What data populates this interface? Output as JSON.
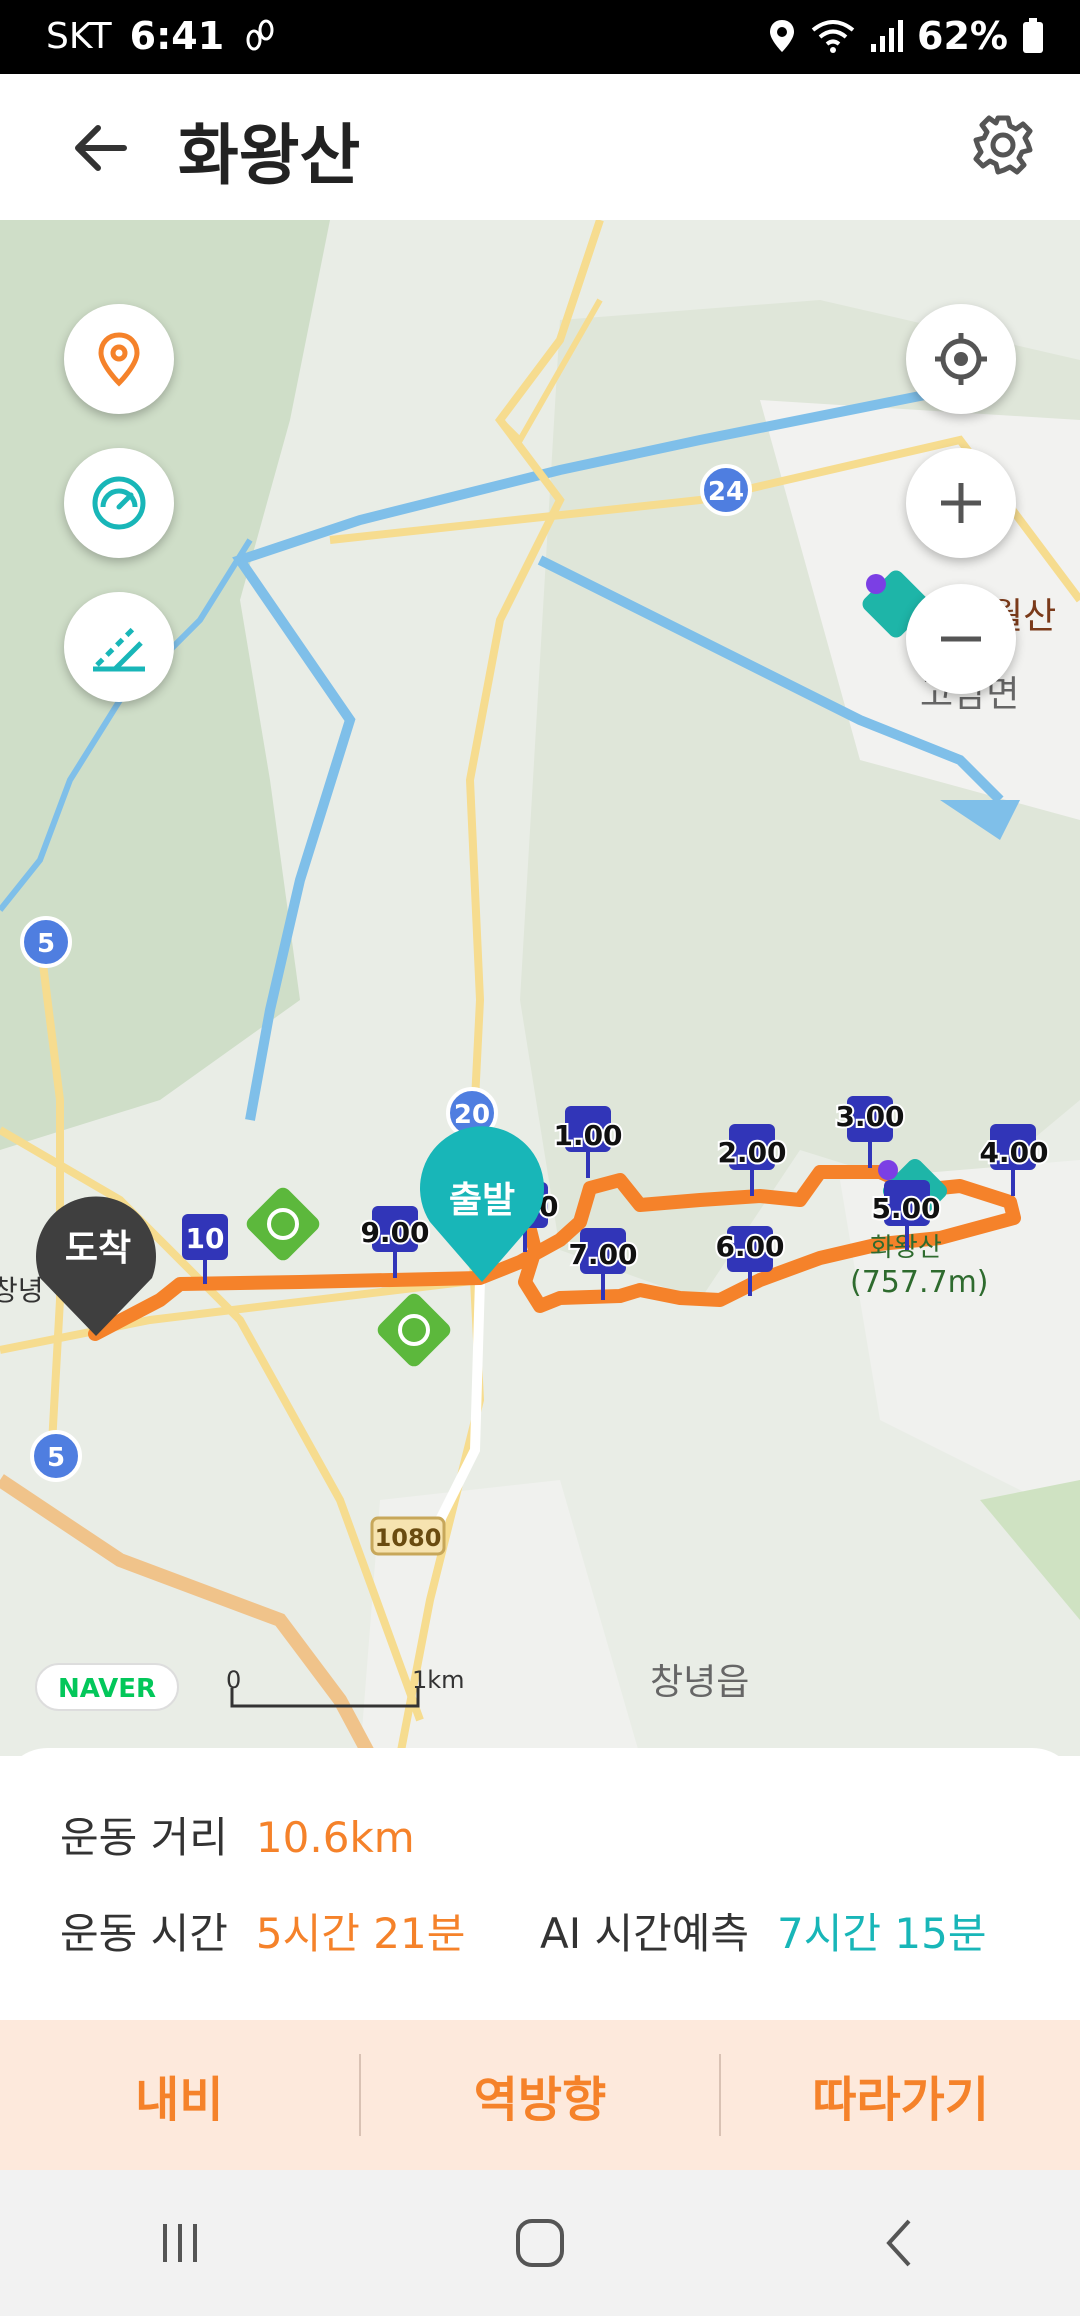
{
  "status_bar": {
    "carrier": "SKT",
    "time": "6:41",
    "battery": "62%"
  },
  "header": {
    "title": "화왕산"
  },
  "map": {
    "place_labels": {
      "top_right_mountain": "월산",
      "top_right_town": "고암면",
      "bottom_town": "창녕읍",
      "left_town": "창녕",
      "peak_name": "화왕산",
      "peak_elevation": "(757.7m)"
    },
    "road_shields": [
      "24",
      "5",
      "20",
      "5",
      "1080"
    ],
    "markers": {
      "start": "출발",
      "end": "도착"
    },
    "km_labels": [
      "1.00",
      "2.00",
      "3.00",
      "4.00",
      "5.00",
      "6.00",
      "7.00",
      "8.00",
      "9.00",
      "10"
    ],
    "scale": {
      "zero": "0",
      "one": "1km"
    },
    "attribution": "NAVER",
    "route_color": "#f5822a",
    "accent_teal": "#18b6b8"
  },
  "stats": {
    "distance_label": "운동 거리",
    "distance_value": "10.6km",
    "time_label": "운동 시간",
    "time_value": "5시간 21분",
    "ai_label": "AI 시간예측",
    "ai_value": "7시간 15분"
  },
  "actions": {
    "navi": "내비",
    "reverse": "역방향",
    "follow": "따라가기"
  }
}
